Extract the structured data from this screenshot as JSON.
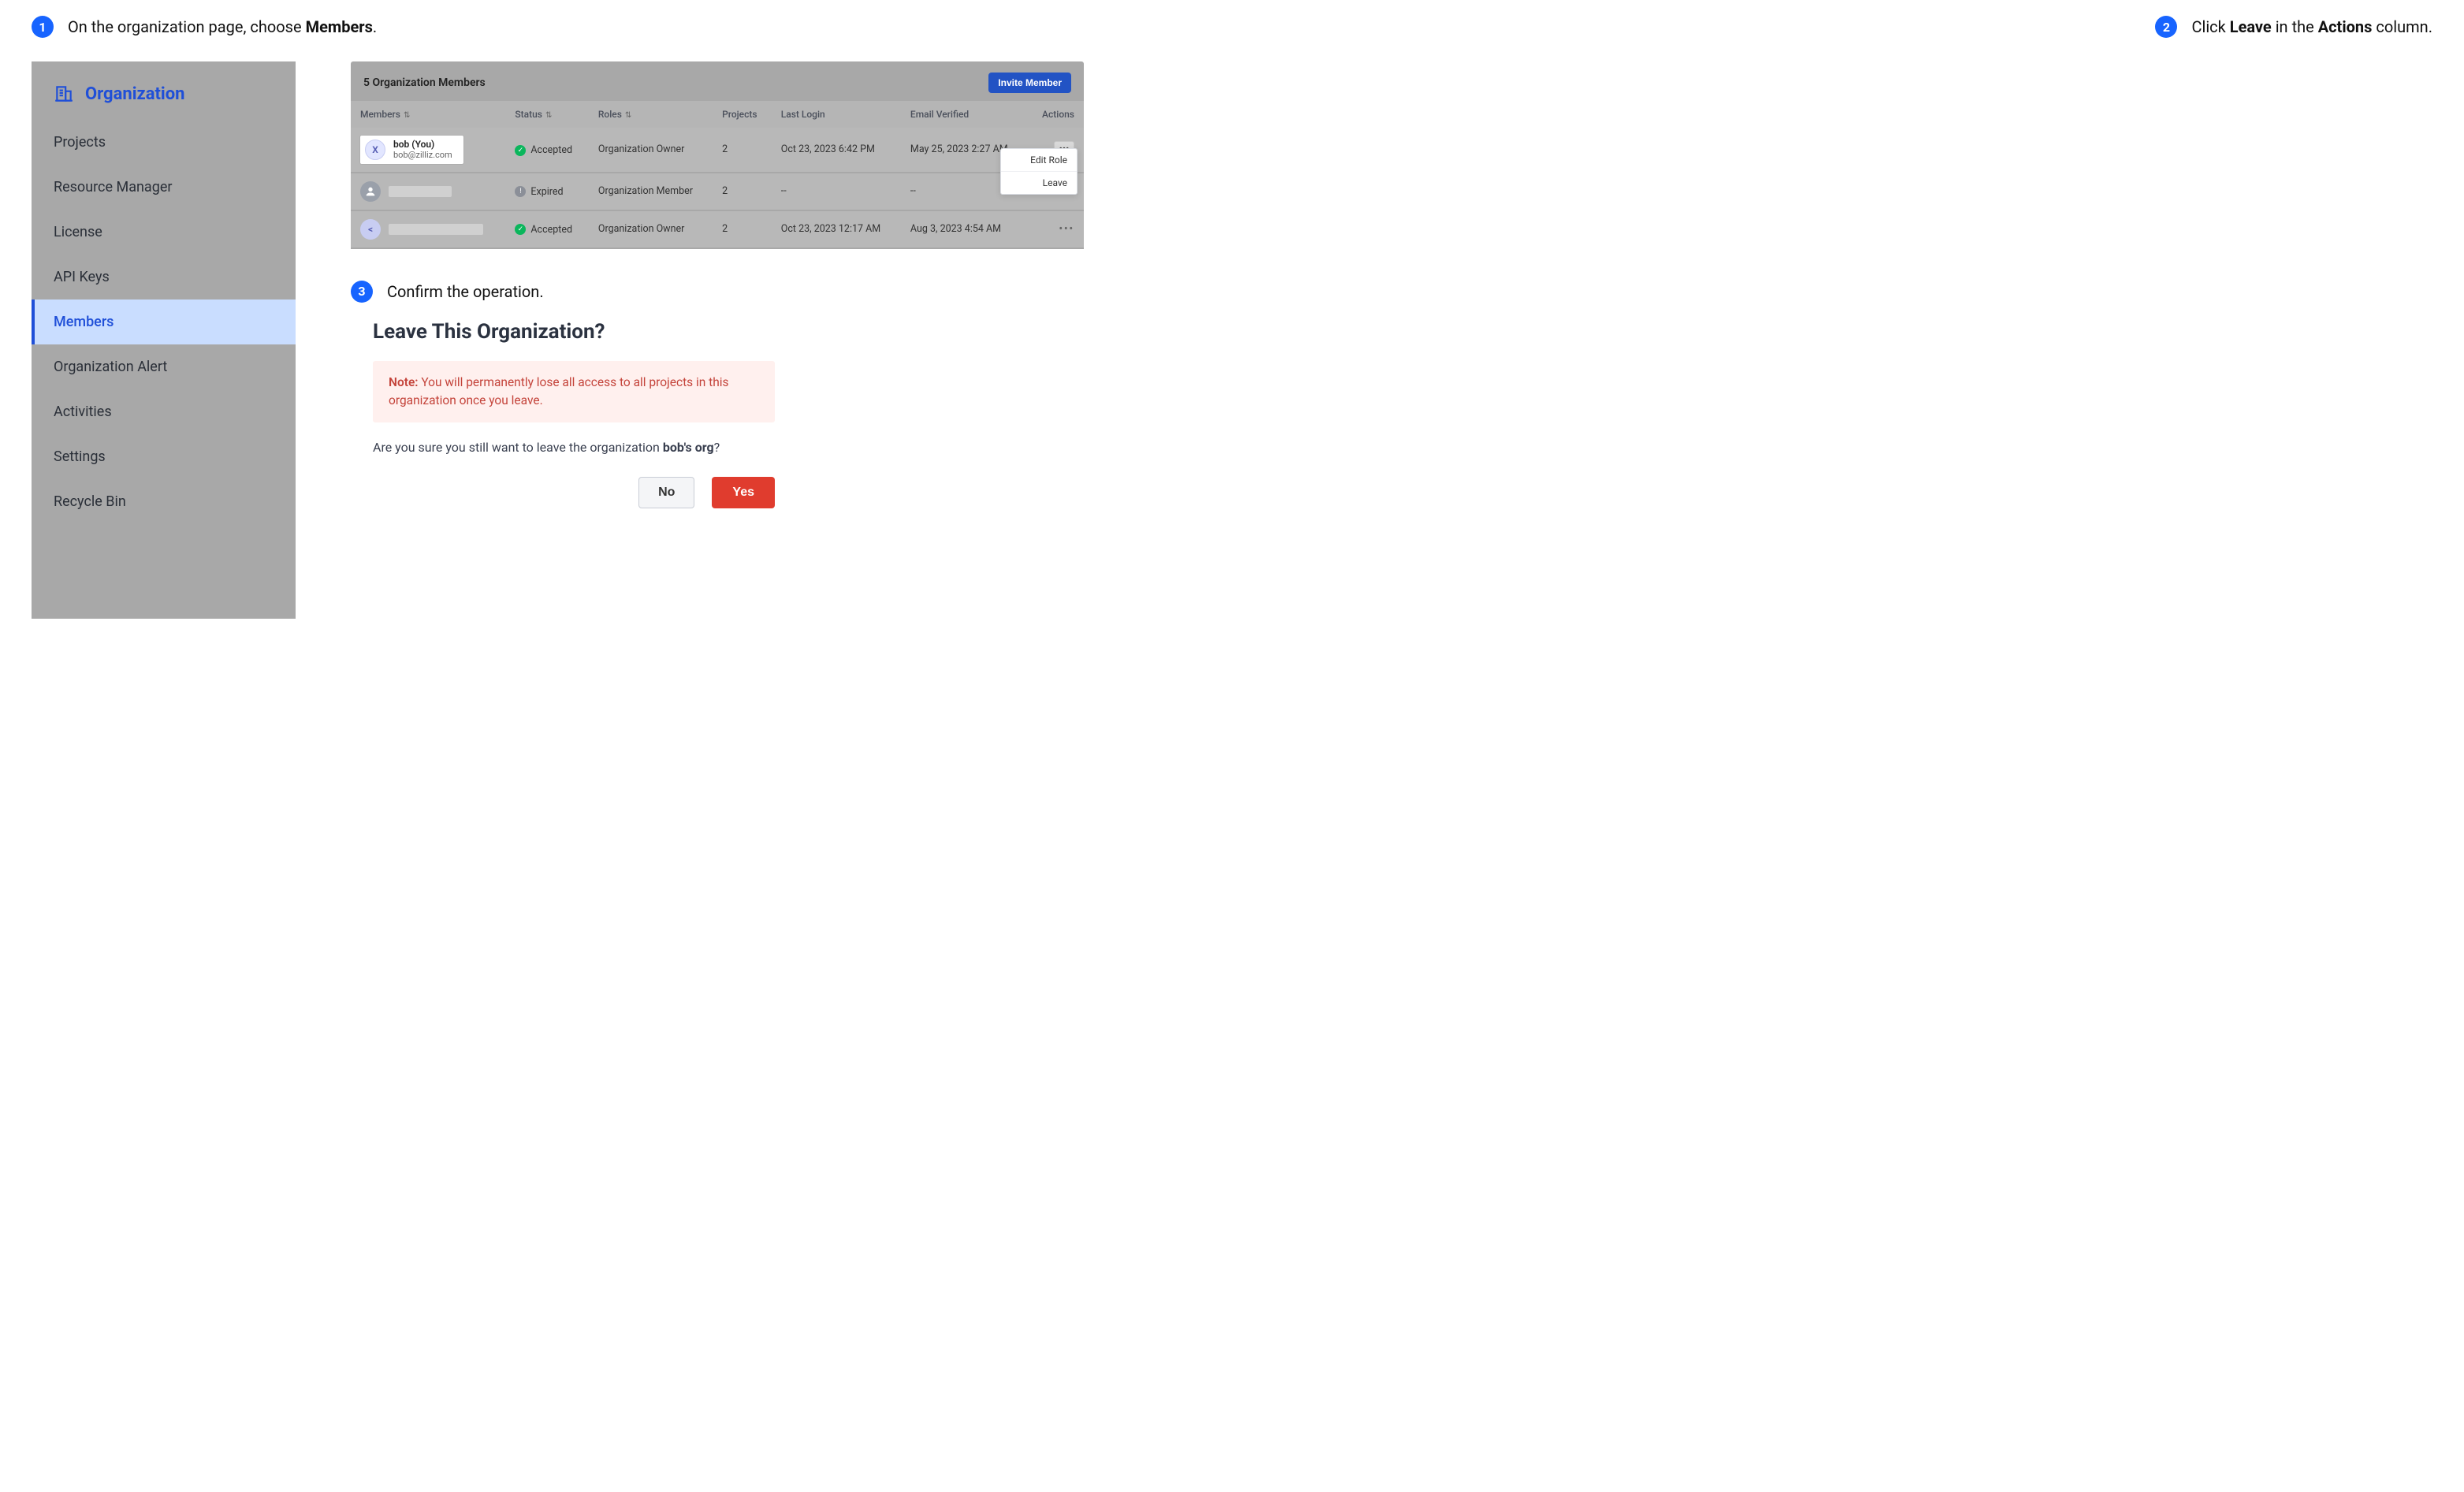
{
  "steps": {
    "s1": {
      "num": "1",
      "pre": "On the organization page, choose ",
      "bold": "Members",
      "post": "."
    },
    "s2": {
      "num": "2",
      "pre": "Click ",
      "bold1": "Leave",
      "mid": " in the ",
      "bold2": "Actions",
      "post": " column."
    },
    "s3": {
      "num": "3",
      "text": "Confirm the operation."
    }
  },
  "sidebar": {
    "title": "Organization",
    "items": [
      "Projects",
      "Resource Manager",
      "License",
      "API Keys",
      "Members",
      "Organization Alert",
      "Activities",
      "Settings",
      "Recycle Bin"
    ],
    "active_index": 4
  },
  "members_panel": {
    "count_label": "5 Organization Members",
    "invite_label": "Invite Member",
    "columns": {
      "members": "Members",
      "status": "Status",
      "roles": "Roles",
      "projects": "Projects",
      "last_login": "Last Login",
      "email_verified": "Email Verified",
      "actions": "Actions"
    },
    "rows": [
      {
        "avatar_letter": "X",
        "name": "bob (You)",
        "email": "bob@zilliz.com",
        "status_text": "Accepted",
        "status_kind": "green",
        "role": "Organization Owner",
        "projects": "2",
        "last_login": "Oct 23, 2023 6:42 PM",
        "email_verified": "May 25, 2023 2:27 AM"
      },
      {
        "status_text": "Expired",
        "status_kind": "gray",
        "role": "Organization Member",
        "projects": "2",
        "last_login": "--",
        "email_verified": "--"
      },
      {
        "avatar_letter": "<",
        "status_text": "Accepted",
        "status_kind": "green",
        "role": "Organization Owner",
        "projects": "2",
        "last_login": "Oct 23, 2023 12:17 AM",
        "email_verified": "Aug 3, 2023 4:54 AM"
      }
    ],
    "actions_menu": {
      "edit": "Edit Role",
      "leave": "Leave"
    }
  },
  "dialog": {
    "title": "Leave This Organization?",
    "note_label": "Note:",
    "note_text": " You will permanently lose all access to all projects in this organization once you leave.",
    "confirm_pre": "Are you sure you still want to leave the organization ",
    "confirm_bold": "bob's org",
    "confirm_post": "?",
    "no": "No",
    "yes": "Yes"
  }
}
